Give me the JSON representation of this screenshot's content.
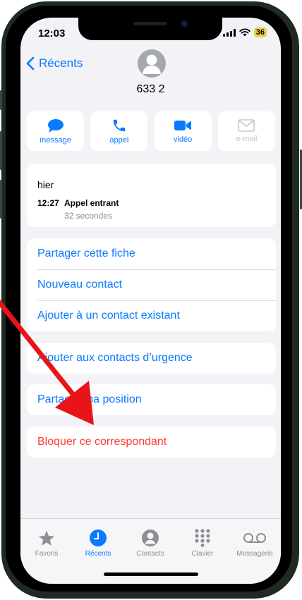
{
  "status": {
    "time": "12:03",
    "battery": "36"
  },
  "header": {
    "back_label": "Récents",
    "contact_name": "633 2"
  },
  "actions": [
    {
      "label": "message",
      "icon": "message-icon"
    },
    {
      "label": "appel",
      "icon": "phone-icon"
    },
    {
      "label": "vidéo",
      "icon": "video-icon"
    },
    {
      "label": "e-mail",
      "icon": "mail-icon",
      "disabled": true
    }
  ],
  "history": {
    "day": "hier",
    "time": "12:27",
    "type": "Appel entrant",
    "duration": "32 secondes"
  },
  "options": {
    "share_card": "Partager cette fiche",
    "new_contact": "Nouveau contact",
    "add_existing": "Ajouter à un contact existant",
    "add_emergency": "Ajouter aux contacts d’urgence",
    "share_location": "Partager ma position",
    "block_caller": "Bloquer ce correspondant"
  },
  "tabs": [
    {
      "label": "Favoris",
      "icon": "star-icon"
    },
    {
      "label": "Récents",
      "icon": "clock-icon",
      "active": true
    },
    {
      "label": "Contacts",
      "icon": "person-icon"
    },
    {
      "label": "Clavier",
      "icon": "keypad-icon"
    },
    {
      "label": "Messagerie",
      "icon": "voicemail-icon"
    }
  ],
  "colors": {
    "accent": "#0a7aff",
    "destructive": "#ff3b30",
    "annotation_arrow": "#e8141a"
  }
}
